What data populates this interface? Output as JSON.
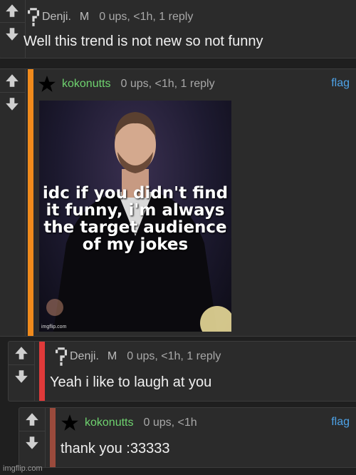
{
  "comments": [
    {
      "username": "Denji.",
      "badge": "M",
      "meta": "0 ups, <1h, 1 reply",
      "text": "Well this trend is not new so not funny"
    },
    {
      "username": "kokonutts",
      "meta": "0 ups, <1h, 1 reply",
      "flag": "flag",
      "meme_text": "idc if you didn't find it funny, i'm always the target audience of my jokes",
      "meme_watermark": "imgflip.com"
    },
    {
      "username": "Denji.",
      "badge": "M",
      "meta": "0 ups, <1h, 1 reply",
      "text": "Yeah i like to laugh at you"
    },
    {
      "username": "kokonutts",
      "meta": "0 ups, <1h",
      "flag": "flag",
      "text": "thank you :33333"
    }
  ],
  "footer": {
    "watermark": "imgflip.com"
  },
  "colors": {
    "accent_orange": "#f08a1c",
    "accent_red": "#e03a3a",
    "accent_brown": "#9a4a3c",
    "username_green": "#6fd36f",
    "flag_blue": "#4ea3e8"
  }
}
